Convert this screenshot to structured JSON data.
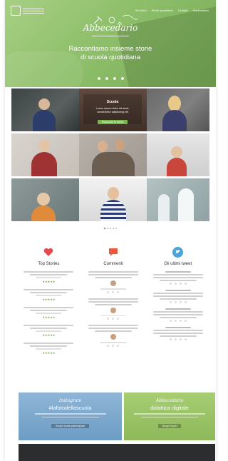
{
  "hero": {
    "brand": "Abbecedario",
    "tagline_line1": "Raccontiamo insieme storie",
    "tagline_line2": "di scuola quotidiana",
    "nav": [
      "Gli Autori",
      "Storie quotidiane",
      "Contatti",
      "Abbecedario"
    ],
    "social_icons": [
      "facebook-icon",
      "twitter-icon",
      "instagram-icon",
      "pinterest-icon"
    ]
  },
  "grid": {
    "featured_title": "Scuola",
    "featured_text": "Lorem ipsum dolor sit amet, consectetur adipiscing elit",
    "featured_button": "Racconta la storia"
  },
  "columns": {
    "stories_title": "Top Stories",
    "comments_title": "Commenti",
    "tweets_title": "Gli ultimi tweet",
    "tweet_author": "Miur Social",
    "icon_colors": {
      "stories": "#e7474f",
      "comments": "#e65b3d",
      "tweets": "#4aa3d9"
    }
  },
  "promos": {
    "instagram_brand": "Instagram",
    "instagram_head": "#lafotodellascuola",
    "instagram_button": "Scopri come partecipare",
    "green_brand": "Abbecedario",
    "green_head": "didattica digitale",
    "green_button": "Scopri di più"
  },
  "colors": {
    "hero": "#8ebf6a",
    "accent": "#78b84a",
    "footer": "#2b2d2f"
  }
}
